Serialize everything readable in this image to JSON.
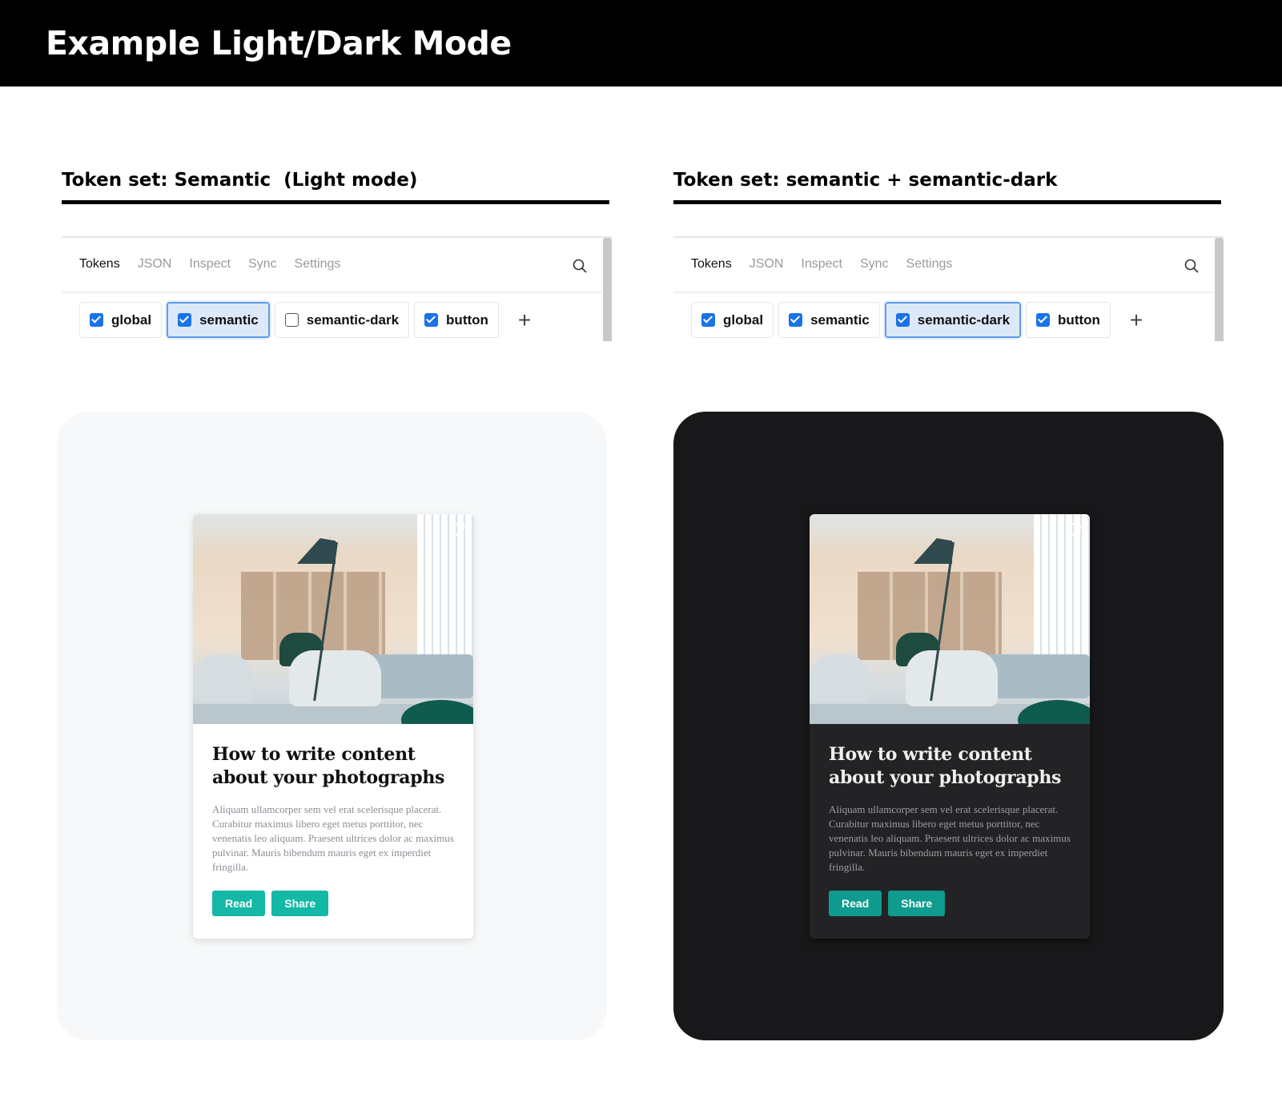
{
  "header": {
    "title": "Example Light/Dark Mode"
  },
  "colors": {
    "accent_light": "#14b8a6",
    "accent_dark": "#0f9b8e",
    "checkbox": "#1a73e8",
    "dark_bg": "#18181a"
  },
  "tabs": [
    "Tokens",
    "JSON",
    "Inspect",
    "Sync",
    "Settings"
  ],
  "left": {
    "title": "Token set: Semantic  (Light mode)",
    "sets": [
      {
        "label": "global",
        "checked": true
      },
      {
        "label": "semantic",
        "checked": true,
        "selected": true
      },
      {
        "label": "semantic-dark",
        "checked": false
      },
      {
        "label": "button",
        "checked": true
      }
    ]
  },
  "right": {
    "title": "Token set: semantic + semantic-dark",
    "sets": [
      {
        "label": "global",
        "checked": true
      },
      {
        "label": "semantic",
        "checked": true
      },
      {
        "label": "semantic-dark",
        "checked": true,
        "selected": true
      },
      {
        "label": "button",
        "checked": true
      }
    ]
  },
  "card": {
    "title": "How to write content about your photographs",
    "text": "Aliquam ullamcorper sem vel erat scelerisque placerat. Curabitur maximus libero eget metus porttitor, nec venenatis leo aliquam. Praesent ultrices dolor ac maximus pulvinar. Mauris bibendum mauris eget ex imperdiet fringilla.",
    "read": "Read",
    "share": "Share"
  },
  "icons": {
    "search": "search-icon",
    "add": "plus-icon",
    "favorite": "heart-icon"
  }
}
